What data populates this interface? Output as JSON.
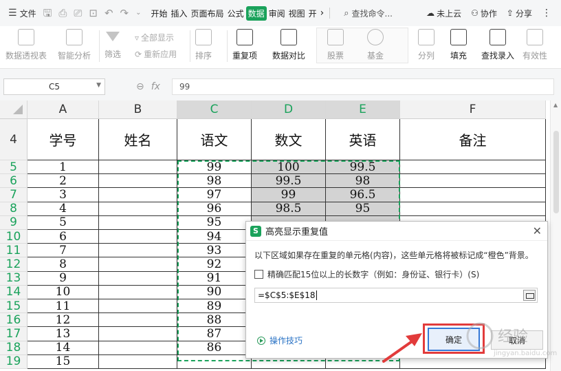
{
  "menubar": {
    "file_label": "文件",
    "tabs": [
      "开始",
      "插入",
      "页面布局",
      "公式",
      "数据",
      "审阅",
      "视图",
      "开"
    ],
    "active_tab": "数据",
    "more": "›",
    "search_placeholder": "查找命令...",
    "cloud_label": "未上云",
    "collab_label": "协作",
    "share_label": "分享"
  },
  "ribbon": {
    "pivot": "数据透视表",
    "smart_analysis": "智能分析",
    "filter": "筛选",
    "show_all": "全部显示",
    "reapply": "重新应用",
    "sort": "排序",
    "duplicates": "重复项",
    "compare": "数据对比",
    "stocks": "股票",
    "funds": "基金",
    "split": "分列",
    "fill": "填充",
    "lookup": "查找录入",
    "validity": "有效性"
  },
  "formula_bar": {
    "name_box": "C5",
    "formula": "99"
  },
  "sheet": {
    "columns": [
      "A",
      "B",
      "C",
      "D",
      "E",
      "F"
    ],
    "selected_columns": [
      "C",
      "D",
      "E"
    ],
    "header_row_num": "4",
    "headers": [
      "学号",
      "姓名",
      "语文",
      "数文",
      "英语",
      "备注"
    ],
    "row_numbers": [
      "5",
      "6",
      "7",
      "8",
      "9",
      "10",
      "11",
      "12",
      "13",
      "14",
      "15",
      "16",
      "17",
      "18",
      "19"
    ],
    "rows": [
      [
        "1",
        "",
        "99",
        "100",
        "99.5",
        ""
      ],
      [
        "2",
        "",
        "98",
        "99.5",
        "98",
        ""
      ],
      [
        "3",
        "",
        "97",
        "99",
        "96.5",
        ""
      ],
      [
        "4",
        "",
        "96",
        "98.5",
        "95",
        ""
      ],
      [
        "5",
        "",
        "95",
        "",
        "",
        ""
      ],
      [
        "6",
        "",
        "94",
        "",
        "",
        ""
      ],
      [
        "7",
        "",
        "93",
        "",
        "",
        ""
      ],
      [
        "8",
        "",
        "92",
        "",
        "",
        ""
      ],
      [
        "9",
        "",
        "91",
        "",
        "",
        ""
      ],
      [
        "10",
        "",
        "90",
        "",
        "",
        ""
      ],
      [
        "11",
        "",
        "89",
        "",
        "",
        ""
      ],
      [
        "12",
        "",
        "88",
        "",
        "",
        ""
      ],
      [
        "13",
        "",
        "87",
        "",
        "",
        ""
      ],
      [
        "14",
        "",
        "86",
        "",
        "",
        ""
      ],
      [
        "15",
        "",
        "",
        "",
        "",
        ""
      ]
    ]
  },
  "dialog": {
    "title": "高亮显示重复值",
    "close": "✕",
    "description": "以下区域如果存在重复的单元格(内容)，这些单元格将被标记成“橙色”背景。",
    "checkbox_label": "精确匹配15位以上的长数字（例如：身份证、银行卡）(S)",
    "range_value": "=$C$5:$E$18",
    "tips_label": "操作技巧",
    "ok_label": "确定",
    "cancel_label": "取消"
  },
  "watermark": {
    "text": "经验",
    "subtext": "jingyan.baidu.com"
  },
  "colors": {
    "accent_green": "#1aa25b",
    "annotation_red": "#e23b3b",
    "selected_gray": "#d3d3d3"
  }
}
